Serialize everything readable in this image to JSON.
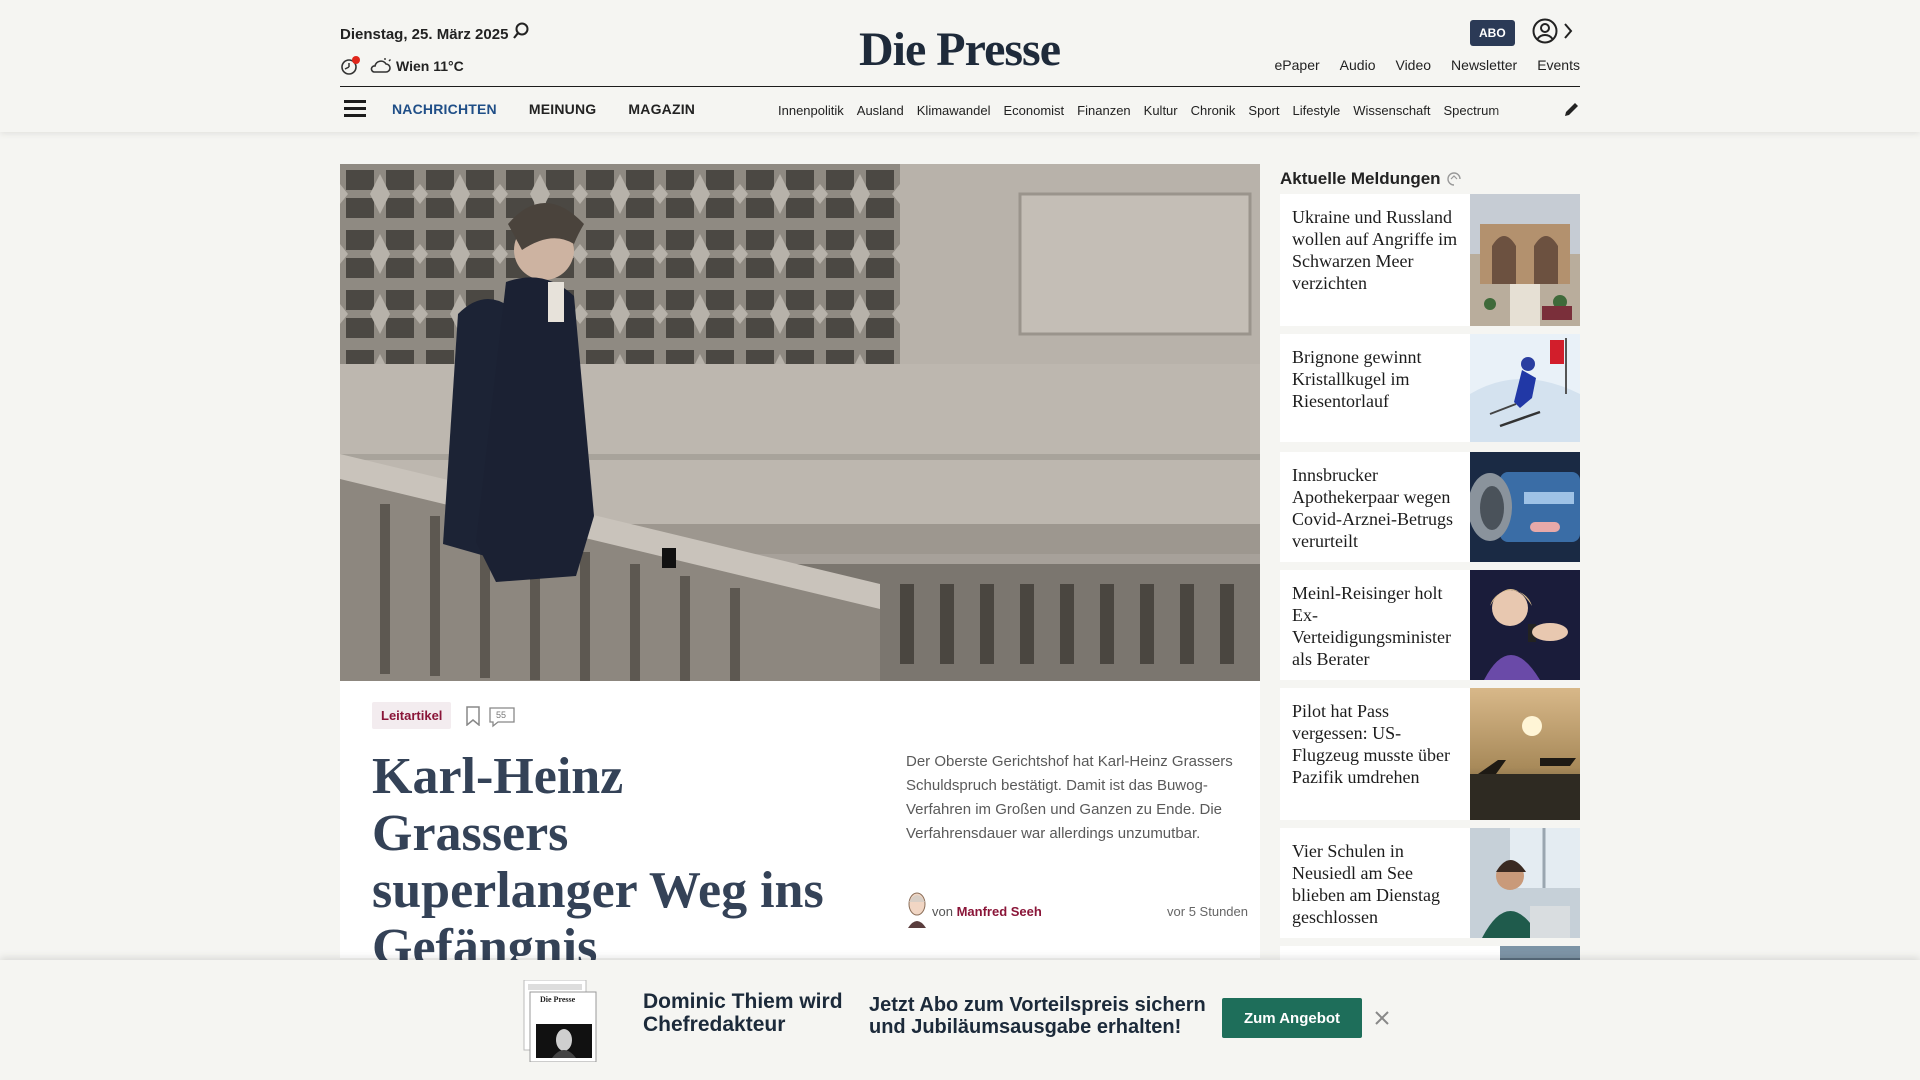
{
  "header": {
    "date": "Dienstag, 25. März 2025",
    "weather": "Wien 11°C",
    "logo": "Die Presse",
    "abo_label": "ABO",
    "top_links": [
      "ePaper",
      "Audio",
      "Video",
      "Newsletter",
      "Events"
    ],
    "main_nav": [
      "NACHRICHTEN",
      "MEINUNG",
      "MAGAZIN"
    ],
    "sub_nav": [
      "Innenpolitik",
      "Ausland",
      "Klimawandel",
      "Economist",
      "Finanzen",
      "Kultur",
      "Chronik",
      "Sport",
      "Lifestyle",
      "Wissenschaft",
      "Spectrum"
    ]
  },
  "lead": {
    "tag": "Leitartikel",
    "comment_count": "55",
    "headline": "Karl-Heinz Grassers superlanger Weg ins Gefängnis",
    "teaser": "Der Oberste Gerichtshof hat Karl-Heinz Grassers Schuldspruch bestätigt. Damit ist das Buwog-Verfahren im Großen und Ganzen zu Ende. Die Verfahrensdauer war allerdings unzumutbar.",
    "byline_prefix": "von",
    "author": "Manfred Seeh",
    "time": "vor 5 Stunden"
  },
  "sidebar": {
    "title": "Aktuelle Meldungen",
    "items": [
      {
        "title": "Ukraine und Russland wollen auf Angriffe im Schwarzen Meer verzichten"
      },
      {
        "title": "Brignone gewinnt Kristallkugel im Riesentorlauf"
      },
      {
        "title": "Innsbrucker Apothekerpaar wegen Covid-Arznei-Betrugs verurteilt"
      },
      {
        "title": "Meinl-Reisinger holt Ex-Verteidigungsminister als Berater"
      },
      {
        "title": "Pilot hat Pass vergessen: US-Flugzeug musste über Pazifik umdrehen"
      },
      {
        "title": "Vier Schulen in Neusiedl am See blieben am Dienstag geschlossen"
      }
    ]
  },
  "banner": {
    "headline": "Dominic Thiem wird Chefredakteur",
    "offer": "Jetzt Abo zum Vorteilspreis sichern und Jubiläumsausgabe erhalten!",
    "button": "Zum Angebot"
  }
}
